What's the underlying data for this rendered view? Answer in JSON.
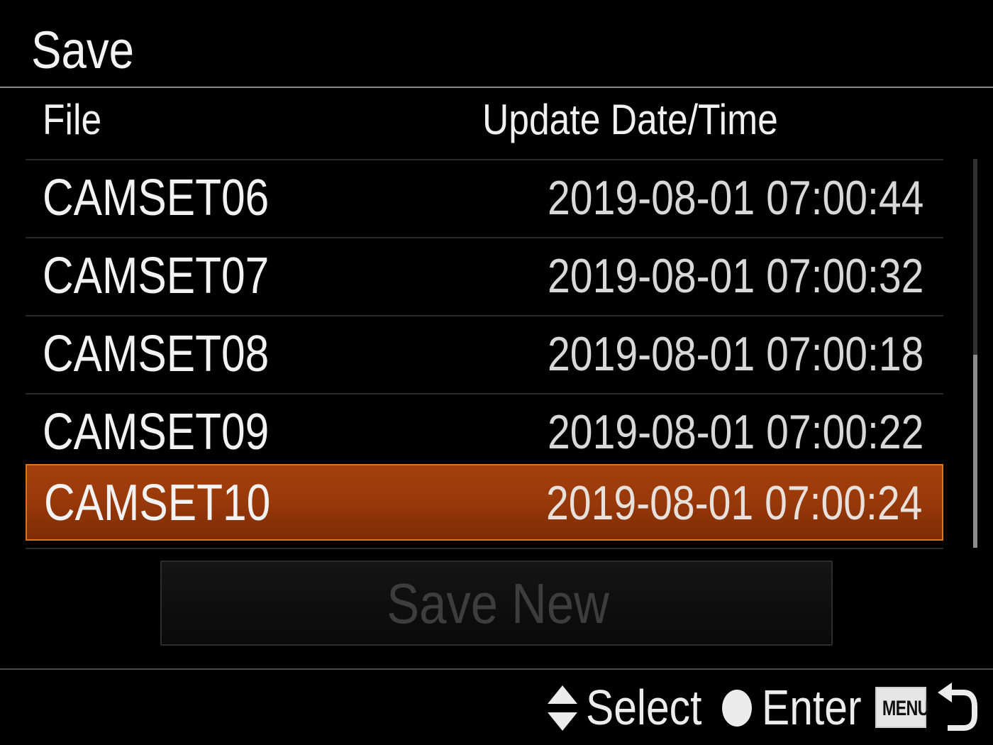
{
  "header": {
    "title": "Save"
  },
  "columns": {
    "file": "File",
    "date": "Update Date/Time"
  },
  "files": [
    {
      "name": "CAMSET06",
      "datetime": "2019-08-01 07:00:44",
      "selected": false
    },
    {
      "name": "CAMSET07",
      "datetime": "2019-08-01 07:00:32",
      "selected": false
    },
    {
      "name": "CAMSET08",
      "datetime": "2019-08-01 07:00:18",
      "selected": false
    },
    {
      "name": "CAMSET09",
      "datetime": "2019-08-01 07:00:22",
      "selected": false
    },
    {
      "name": "CAMSET10",
      "datetime": "2019-08-01 07:00:24",
      "selected": true
    }
  ],
  "save_new": {
    "label": "Save New",
    "enabled": false
  },
  "footer": {
    "select_label": "Select",
    "enter_label": "Enter",
    "menu_label": "MENU",
    "select_icon": "up-down-arrows-icon",
    "enter_icon": "center-button-icon",
    "back_icon": "return-arrow-icon"
  },
  "colors": {
    "background": "#000000",
    "selection": "#9a3a0a",
    "selection_border": "#e0741a",
    "disabled_text": "#3d3d3d"
  }
}
